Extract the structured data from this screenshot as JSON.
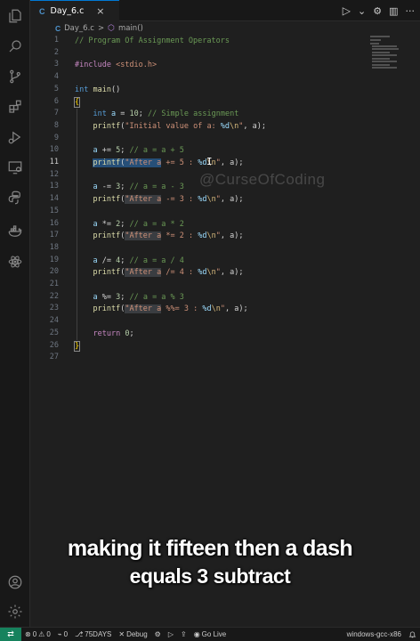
{
  "tab": {
    "file_type": "C",
    "name": "Day_6.c",
    "close": "×"
  },
  "tab_actions": {
    "run": "▷",
    "run_dropdown": "⌄",
    "settings": "⚙",
    "split": "▥",
    "more": "···"
  },
  "breadcrumb": {
    "file_type": "C",
    "file": "Day_6.c",
    "sep": ">",
    "symbol_icon": "⬡",
    "symbol": "main()"
  },
  "editor": {
    "line_numbers": [
      "1",
      "2",
      "3",
      "4",
      "5",
      "6",
      "7",
      "8",
      "9",
      "10",
      "11",
      "12",
      "13",
      "14",
      "15",
      "16",
      "17",
      "18",
      "19",
      "20",
      "21",
      "22",
      "23",
      "24",
      "25",
      "26",
      "27"
    ],
    "line1": {
      "comment": "// Program Of Assignment Operators"
    },
    "line3": {
      "directive": "#include",
      "header": "<stdio.h>"
    },
    "line5": {
      "type": "int",
      "name": "main",
      "parens": "()"
    },
    "line6": {
      "brace": "{"
    },
    "line7": {
      "type": "int",
      "var": "a",
      "op": "=",
      "num": "10",
      "semi": ";",
      "comment": "// Simple assignment"
    },
    "line8": {
      "fn": "printf",
      "open": "(",
      "str1": "\"Initial value of a: ",
      "fmt": "%d",
      "esc": "\\n",
      "str2": "\"",
      "rest": ", a);"
    },
    "line10": {
      "var": "a",
      "op": "+=",
      "num": "5",
      "semi": ";",
      "comment": "// a = a + 5"
    },
    "line11": {
      "fn": "printf",
      "open": "(",
      "str_sel": "\"After a",
      "str_rest": " += 5 : ",
      "fmt": "%d",
      "esc": "\\n",
      "str_end": "\"",
      "rest": ", a);"
    },
    "line13": {
      "var": "a",
      "op": "-=",
      "num": "3",
      "semi": ";",
      "comment": "// a = a - 3"
    },
    "line14": {
      "fn": "printf",
      "open": "(",
      "str_hl": "\"After a",
      "str_rest": " -= 3 : ",
      "fmt": "%d",
      "esc": "\\n",
      "str_end": "\"",
      "rest": ", a);"
    },
    "line16": {
      "var": "a",
      "op": "*=",
      "num": "2",
      "semi": ";",
      "comment": "// a = a * 2"
    },
    "line17": {
      "fn": "printf",
      "open": "(",
      "str_hl": "\"After a",
      "str_rest": " *= 2 : ",
      "fmt": "%d",
      "esc": "\\n",
      "str_end": "\"",
      "rest": ", a);"
    },
    "line19": {
      "var": "a",
      "op": "/=",
      "num": "4",
      "semi": ";",
      "comment": "// a = a / 4"
    },
    "line20": {
      "fn": "printf",
      "open": "(",
      "str_hl": "\"After a",
      "str_rest": " /= 4 : ",
      "fmt": "%d",
      "esc": "\\n",
      "str_end": "\"",
      "rest": ", a);"
    },
    "line22": {
      "var": "a",
      "op": "%=",
      "num": "3",
      "semi": ";",
      "comment": "// a = a % 3"
    },
    "line23": {
      "fn": "printf",
      "open": "(",
      "str_hl": "\"After a",
      "str_rest": " %%= 3 : ",
      "fmt": "%d",
      "esc": "\\n",
      "str_end": "\"",
      "rest": ", a);"
    },
    "line25": {
      "kw": "return",
      "num": "0",
      "semi": ";"
    },
    "line26": {
      "brace": "}"
    }
  },
  "watermark": "@CurseOfCoding",
  "subtitles": {
    "line1": "making it fifteen then a dash",
    "line2": "equals 3 subtract"
  },
  "statusbar": {
    "remote_icon": "⇄",
    "errors": "0",
    "warnings": "0",
    "warnings_icon": "⚠",
    "errors_icon": "⊗",
    "ports": "0",
    "branch": "75DAYS",
    "debug": "Debug",
    "live_share": "⇪",
    "go_live": "Go Live",
    "compiler": "windows-gcc-x86",
    "bell": "🔔"
  },
  "colors": {
    "accent": "#0078d4",
    "remote": "#16825d",
    "keyword": "#569cd6",
    "string": "#ce9178",
    "comment": "#6a9955",
    "function": "#dcdcaa",
    "number": "#b5cea8"
  }
}
